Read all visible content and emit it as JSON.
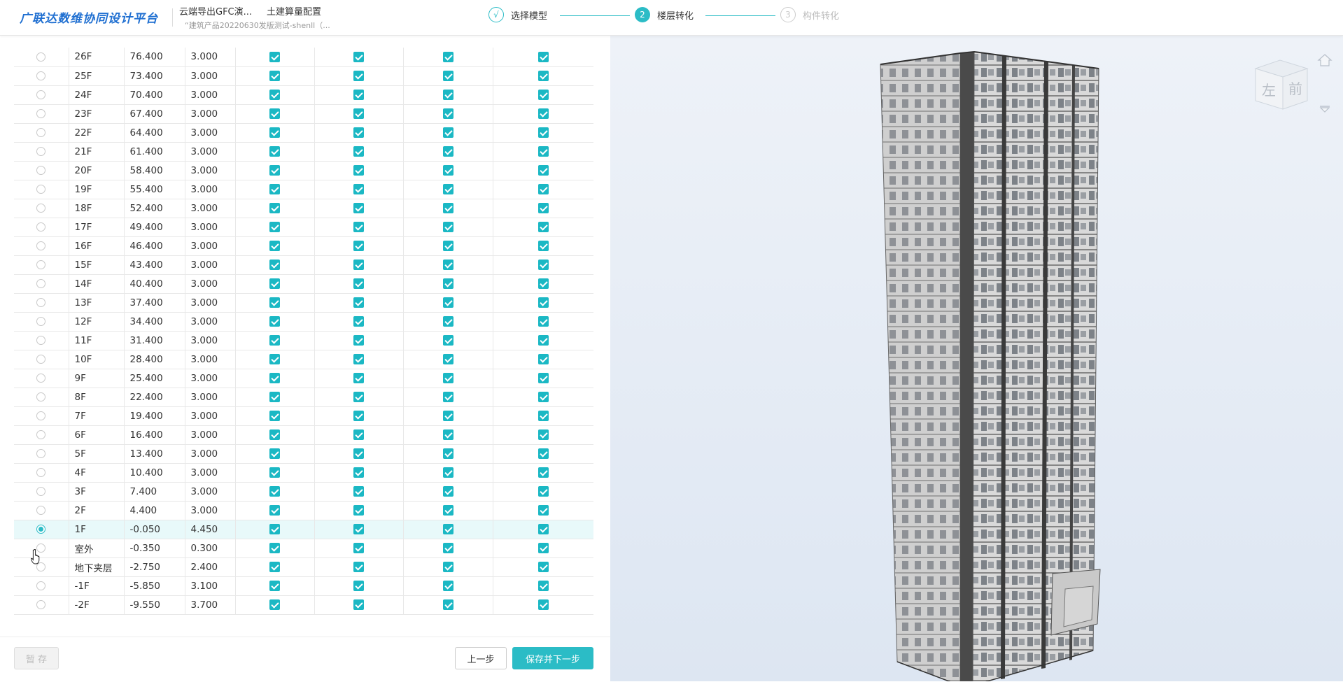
{
  "app": {
    "logo": "广联达数维协同设计平台"
  },
  "header": {
    "project_title": "云端导出GFC演...",
    "project_subtitle": "“建筑产品20220630发版测试-shenll（...",
    "config_title": "土建算量配置"
  },
  "steps": [
    {
      "num": "√",
      "label": "选择模型",
      "state": "done"
    },
    {
      "num": "2",
      "label": "楼层转化",
      "state": "active"
    },
    {
      "num": "3",
      "label": "构件转化",
      "state": "todo"
    }
  ],
  "floors": [
    {
      "name": "26F",
      "elevation": "76.400",
      "height": "3.000",
      "selected": false
    },
    {
      "name": "25F",
      "elevation": "73.400",
      "height": "3.000",
      "selected": false
    },
    {
      "name": "24F",
      "elevation": "70.400",
      "height": "3.000",
      "selected": false
    },
    {
      "name": "23F",
      "elevation": "67.400",
      "height": "3.000",
      "selected": false
    },
    {
      "name": "22F",
      "elevation": "64.400",
      "height": "3.000",
      "selected": false
    },
    {
      "name": "21F",
      "elevation": "61.400",
      "height": "3.000",
      "selected": false
    },
    {
      "name": "20F",
      "elevation": "58.400",
      "height": "3.000",
      "selected": false
    },
    {
      "name": "19F",
      "elevation": "55.400",
      "height": "3.000",
      "selected": false
    },
    {
      "name": "18F",
      "elevation": "52.400",
      "height": "3.000",
      "selected": false
    },
    {
      "name": "17F",
      "elevation": "49.400",
      "height": "3.000",
      "selected": false
    },
    {
      "name": "16F",
      "elevation": "46.400",
      "height": "3.000",
      "selected": false
    },
    {
      "name": "15F",
      "elevation": "43.400",
      "height": "3.000",
      "selected": false
    },
    {
      "name": "14F",
      "elevation": "40.400",
      "height": "3.000",
      "selected": false
    },
    {
      "name": "13F",
      "elevation": "37.400",
      "height": "3.000",
      "selected": false
    },
    {
      "name": "12F",
      "elevation": "34.400",
      "height": "3.000",
      "selected": false
    },
    {
      "name": "11F",
      "elevation": "31.400",
      "height": "3.000",
      "selected": false
    },
    {
      "name": "10F",
      "elevation": "28.400",
      "height": "3.000",
      "selected": false
    },
    {
      "name": "9F",
      "elevation": "25.400",
      "height": "3.000",
      "selected": false
    },
    {
      "name": "8F",
      "elevation": "22.400",
      "height": "3.000",
      "selected": false
    },
    {
      "name": "7F",
      "elevation": "19.400",
      "height": "3.000",
      "selected": false
    },
    {
      "name": "6F",
      "elevation": "16.400",
      "height": "3.000",
      "selected": false
    },
    {
      "name": "5F",
      "elevation": "13.400",
      "height": "3.000",
      "selected": false
    },
    {
      "name": "4F",
      "elevation": "10.400",
      "height": "3.000",
      "selected": false
    },
    {
      "name": "3F",
      "elevation": "7.400",
      "height": "3.000",
      "selected": false
    },
    {
      "name": "2F",
      "elevation": "4.400",
      "height": "3.000",
      "selected": false
    },
    {
      "name": "1F",
      "elevation": "-0.050",
      "height": "4.450",
      "selected": true
    },
    {
      "name": "室外",
      "elevation": "-0.350",
      "height": "0.300",
      "selected": false
    },
    {
      "name": "地下夹层",
      "elevation": "-2.750",
      "height": "2.400",
      "selected": false
    },
    {
      "name": "-1F",
      "elevation": "-5.850",
      "height": "3.100",
      "selected": false
    },
    {
      "name": "-2F",
      "elevation": "-9.550",
      "height": "3.700",
      "selected": false
    }
  ],
  "footer": {
    "temp_save_label": "暂 存",
    "prev_label": "上一步",
    "next_label": "保存并下一步"
  },
  "viewer": {
    "view_cube": {
      "left_face": "左",
      "front_face": "前"
    },
    "accent_color": "#2bbcc6"
  }
}
